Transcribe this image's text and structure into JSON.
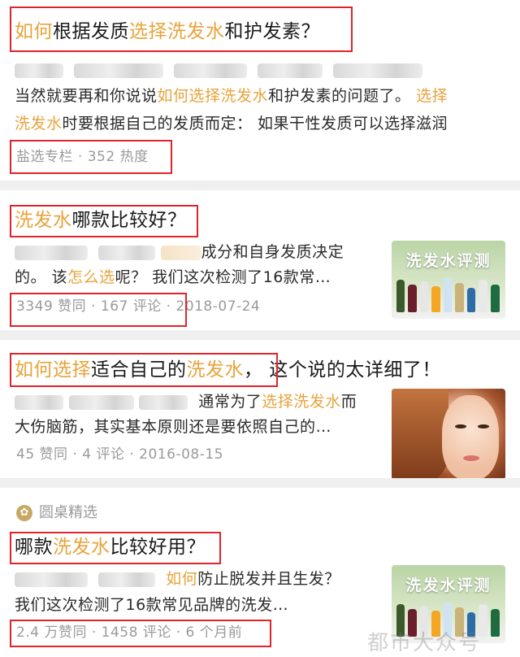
{
  "cards": [
    {
      "title": [
        {
          "text": "如何",
          "hl": true
        },
        {
          "text": "根据发质",
          "hl": false
        },
        {
          "text": "选择洗发水",
          "hl": true
        },
        {
          "text": "和护发素？",
          "hl": false
        }
      ],
      "line2": [
        {
          "text": "当然就要再和你说说",
          "hl": false
        },
        {
          "text": "如何选择洗发水",
          "hl": true
        },
        {
          "text": "和护发素的问题了。",
          "hl": false
        },
        {
          "text": "选择",
          "hl": true
        }
      ],
      "line3": [
        {
          "text": "洗发水",
          "hl": true
        },
        {
          "text": "时要根据自己的发质而定：  如果干性发质可以选择滋润",
          "hl": false
        }
      ],
      "meta": "盐选专栏 · 352 热度"
    },
    {
      "title": [
        {
          "text": "洗发水",
          "hl": true
        },
        {
          "text": "哪款比较好？",
          "hl": false
        }
      ],
      "line1_tail": "成分和自身发质决定",
      "line2": [
        {
          "text": "的。 该",
          "hl": false
        },
        {
          "text": "怎么选",
          "hl": true
        },
        {
          "text": "呢？ 我们这次检测了16款常…",
          "hl": false
        }
      ],
      "meta": "3349 赞同 · 167 评论 · 2018-07-24",
      "thumb_title": "洗发水评测"
    },
    {
      "title": [
        {
          "text": "如何选择",
          "hl": true
        },
        {
          "text": "适合自己的",
          "hl": false
        },
        {
          "text": "洗发水",
          "hl": true
        },
        {
          "text": "，",
          "hl": false
        },
        {
          "text": "这个说的太详细了！",
          "hl": false
        }
      ],
      "line1": [
        {
          "text": "通常为了",
          "hl": false
        },
        {
          "text": "选择洗发水",
          "hl": true
        },
        {
          "text": "而",
          "hl": false
        }
      ],
      "line2": "大伤脑筋，其实基本原则还是要依照自己的…",
      "meta": "45 赞同 · 4 评论 · 2016-08-15"
    },
    {
      "brand": "圆桌精选",
      "title": [
        {
          "text": "哪款",
          "hl": false
        },
        {
          "text": "洗发水",
          "hl": true
        },
        {
          "text": "比较好用？",
          "hl": false
        }
      ],
      "line1": [
        {
          "text": "如何",
          "hl": true
        },
        {
          "text": "防止脱发并且生发？",
          "hl": false
        }
      ],
      "line2": "我们这次检测了16款常见品牌的洗发…",
      "meta": "2.4 万赞同 · 1458 评论 · 6 个月前",
      "thumb_title": "洗发水评测"
    }
  ],
  "watermark": "都市大众号",
  "colors": {
    "highlight": "#e8a33b",
    "annotation": "#e0242b",
    "meta": "#9a9a9a"
  }
}
